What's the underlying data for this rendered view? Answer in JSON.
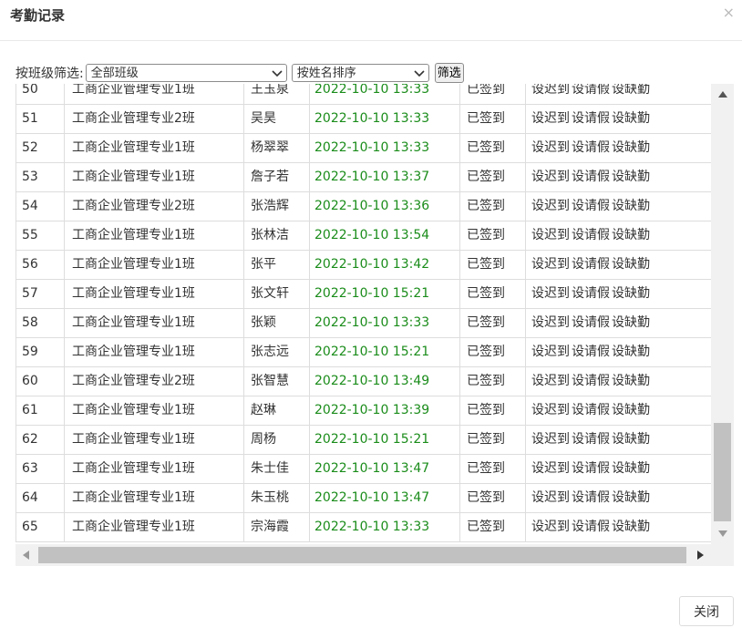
{
  "dialog": {
    "title": "考勤记录",
    "close_icon": "×",
    "close_button": "关闭"
  },
  "filter": {
    "label": "按班级筛选:",
    "class_select": "全部班级",
    "sort_select": "按姓名排序",
    "filter_button": "筛选"
  },
  "actions": [
    "设迟到",
    "设请假",
    "设缺勤"
  ],
  "colors": {
    "time": "#1a8c1a"
  },
  "rows": [
    {
      "no": "50",
      "class": "工商企业管理专业1班",
      "name": "王玉泉",
      "time": "2022-10-10 13:33",
      "status": "已签到"
    },
    {
      "no": "51",
      "class": "工商企业管理专业2班",
      "name": "吴昊",
      "time": "2022-10-10 13:33",
      "status": "已签到"
    },
    {
      "no": "52",
      "class": "工商企业管理专业1班",
      "name": "杨翠翠",
      "time": "2022-10-10 13:33",
      "status": "已签到"
    },
    {
      "no": "53",
      "class": "工商企业管理专业1班",
      "name": "詹子若",
      "time": "2022-10-10 13:37",
      "status": "已签到"
    },
    {
      "no": "54",
      "class": "工商企业管理专业2班",
      "name": "张浩辉",
      "time": "2022-10-10 13:36",
      "status": "已签到"
    },
    {
      "no": "55",
      "class": "工商企业管理专业1班",
      "name": "张林洁",
      "time": "2022-10-10 13:54",
      "status": "已签到"
    },
    {
      "no": "56",
      "class": "工商企业管理专业1班",
      "name": "张平",
      "time": "2022-10-10 13:42",
      "status": "已签到"
    },
    {
      "no": "57",
      "class": "工商企业管理专业1班",
      "name": "张文轩",
      "time": "2022-10-10 15:21",
      "status": "已签到"
    },
    {
      "no": "58",
      "class": "工商企业管理专业1班",
      "name": "张颖",
      "time": "2022-10-10 13:33",
      "status": "已签到"
    },
    {
      "no": "59",
      "class": "工商企业管理专业1班",
      "name": "张志远",
      "time": "2022-10-10 15:21",
      "status": "已签到"
    },
    {
      "no": "60",
      "class": "工商企业管理专业2班",
      "name": "张智慧",
      "time": "2022-10-10 13:49",
      "status": "已签到"
    },
    {
      "no": "61",
      "class": "工商企业管理专业1班",
      "name": "赵琳",
      "time": "2022-10-10 13:39",
      "status": "已签到"
    },
    {
      "no": "62",
      "class": "工商企业管理专业1班",
      "name": "周杨",
      "time": "2022-10-10 15:21",
      "status": "已签到"
    },
    {
      "no": "63",
      "class": "工商企业管理专业1班",
      "name": "朱士佳",
      "time": "2022-10-10 13:47",
      "status": "已签到"
    },
    {
      "no": "64",
      "class": "工商企业管理专业1班",
      "name": "朱玉桃",
      "time": "2022-10-10 13:47",
      "status": "已签到"
    },
    {
      "no": "65",
      "class": "工商企业管理专业1班",
      "name": "宗海霞",
      "time": "2022-10-10 13:33",
      "status": "已签到"
    }
  ]
}
